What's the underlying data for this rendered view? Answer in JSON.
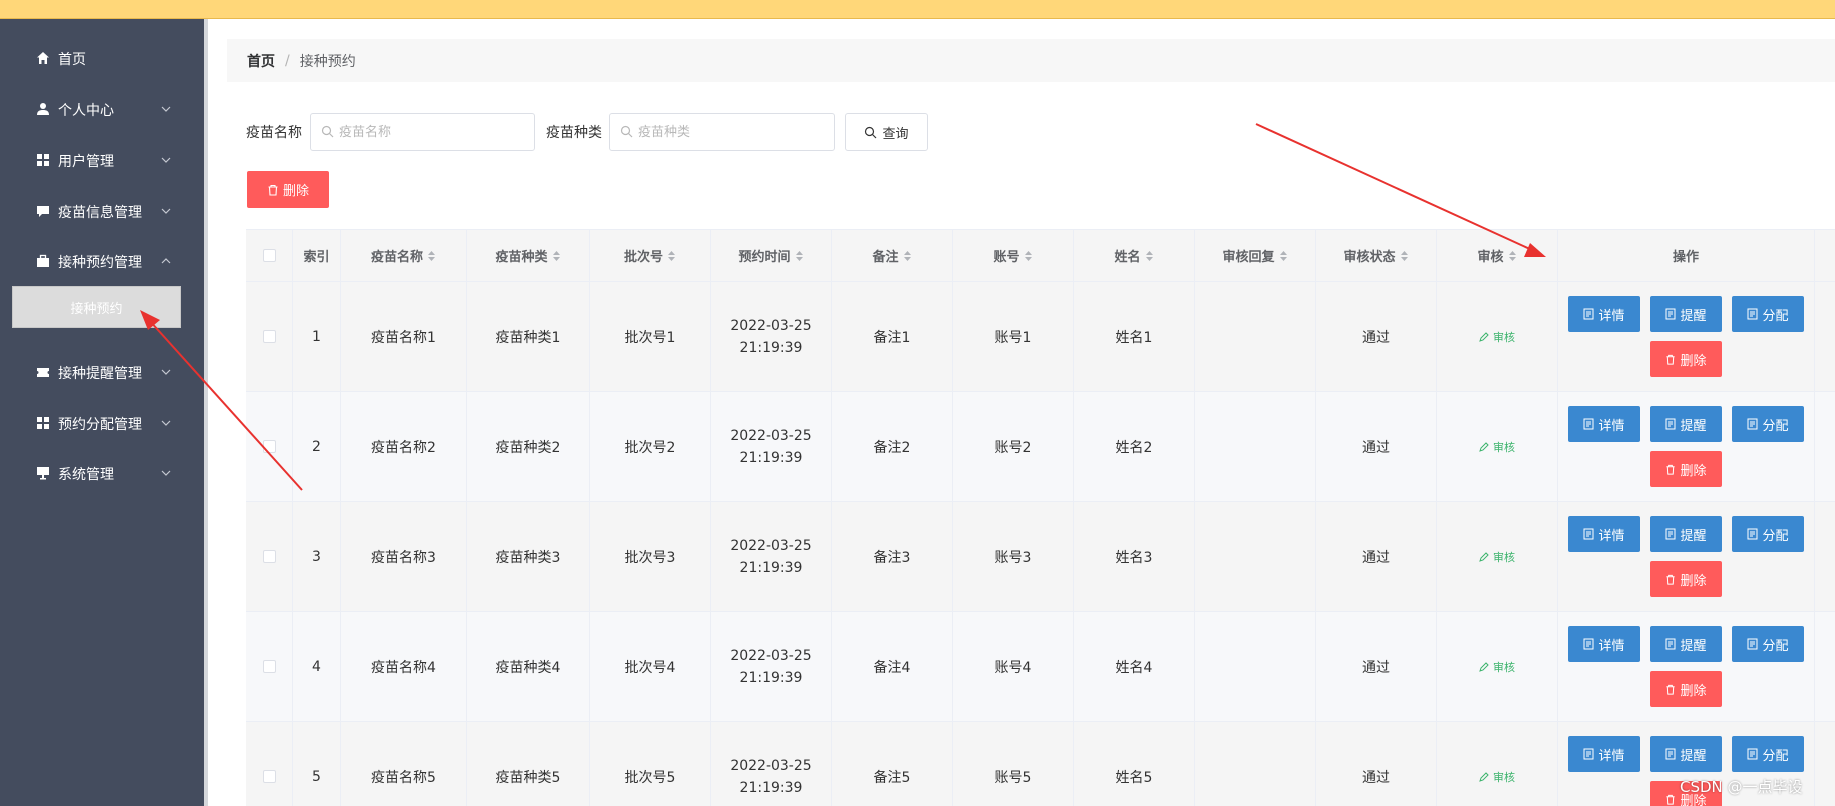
{
  "breadcrumb": {
    "home": "首页",
    "separator": "/",
    "current": "接种预约"
  },
  "sidebar": {
    "items": [
      {
        "label": "首页",
        "icon": "home-icon",
        "has_children": false
      },
      {
        "label": "个人中心",
        "icon": "user-icon",
        "has_children": true
      },
      {
        "label": "用户管理",
        "icon": "grid-icon",
        "has_children": true
      },
      {
        "label": "疫苗信息管理",
        "icon": "chat-icon",
        "has_children": true
      },
      {
        "label": "接种预约管理",
        "icon": "briefcase-icon",
        "has_children": true,
        "expanded": true
      },
      {
        "label": "接种提醒管理",
        "icon": "ticket-icon",
        "has_children": true
      },
      {
        "label": "预约分配管理",
        "icon": "grid-icon",
        "has_children": true
      },
      {
        "label": "系统管理",
        "icon": "monitor-icon",
        "has_children": true
      }
    ],
    "active_sub": "接种预约"
  },
  "search": {
    "name_label": "疫苗名称",
    "name_placeholder": "疫苗名称",
    "type_label": "疫苗种类",
    "type_placeholder": "疫苗种类",
    "query_button": "查询"
  },
  "toolbar": {
    "delete_label": "删除"
  },
  "table": {
    "headers": [
      "索引",
      "疫苗名称",
      "疫苗种类",
      "批次号",
      "预约时间",
      "备注",
      "账号",
      "姓名",
      "审核回复",
      "审核状态",
      "审核",
      "操作"
    ],
    "rows": [
      {
        "index": "1",
        "vaccine_name": "疫苗名称1",
        "vaccine_type": "疫苗种类1",
        "batch": "批次号1",
        "time": "2022-03-25 21:19:39",
        "note": "备注1",
        "account": "账号1",
        "name": "姓名1",
        "reply": "",
        "status": "通过",
        "audit": "审核"
      },
      {
        "index": "2",
        "vaccine_name": "疫苗名称2",
        "vaccine_type": "疫苗种类2",
        "batch": "批次号2",
        "time": "2022-03-25 21:19:39",
        "note": "备注2",
        "account": "账号2",
        "name": "姓名2",
        "reply": "",
        "status": "通过",
        "audit": "审核"
      },
      {
        "index": "3",
        "vaccine_name": "疫苗名称3",
        "vaccine_type": "疫苗种类3",
        "batch": "批次号3",
        "time": "2022-03-25 21:19:39",
        "note": "备注3",
        "account": "账号3",
        "name": "姓名3",
        "reply": "",
        "status": "通过",
        "audit": "审核"
      },
      {
        "index": "4",
        "vaccine_name": "疫苗名称4",
        "vaccine_type": "疫苗种类4",
        "batch": "批次号4",
        "time": "2022-03-25 21:19:39",
        "note": "备注4",
        "account": "账号4",
        "name": "姓名4",
        "reply": "",
        "status": "通过",
        "audit": "审核"
      },
      {
        "index": "5",
        "vaccine_name": "疫苗名称5",
        "vaccine_type": "疫苗种类5",
        "batch": "批次号5",
        "time": "2022-03-25 21:19:39",
        "note": "备注5",
        "account": "账号5",
        "name": "姓名5",
        "reply": "",
        "status": "通过",
        "audit": "审核"
      }
    ],
    "actions": {
      "detail": "详情",
      "remind": "提醒",
      "assign": "分配",
      "delete": "删除"
    }
  },
  "watermark": "CSDN @一点毕设",
  "colors": {
    "topbar": "#ffd779",
    "sidebar": "#444c5e",
    "primary": "#3a88d0",
    "danger": "#ff5b5b",
    "success": "#3bb36b",
    "arrow": "#e8322f"
  }
}
